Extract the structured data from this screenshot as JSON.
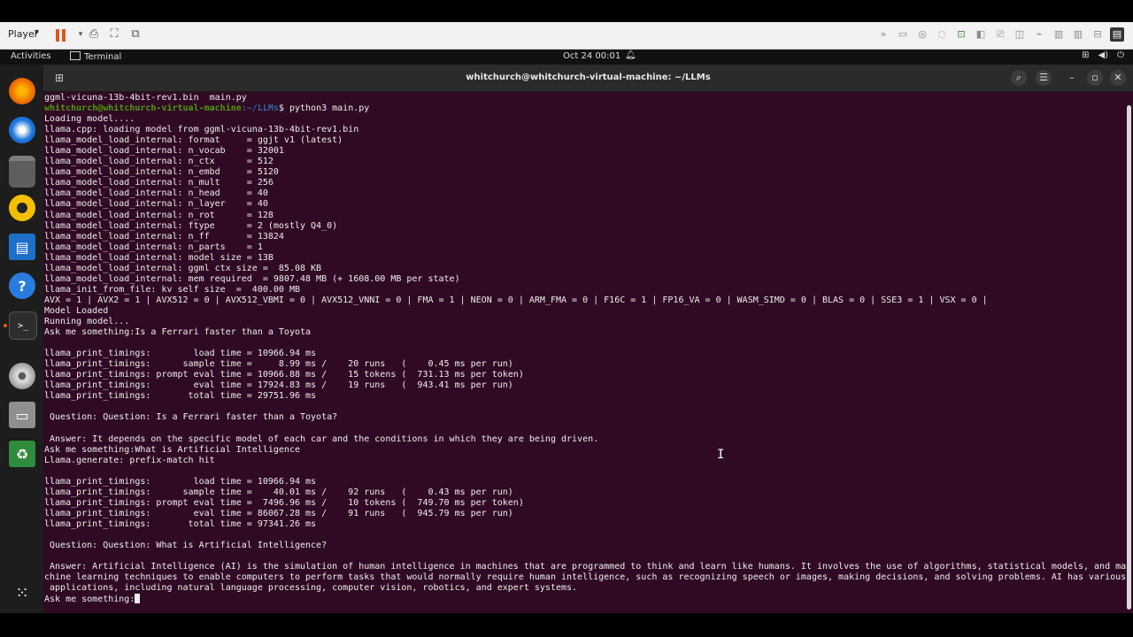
{
  "player": {
    "label": "Player",
    "icons": [
      "pause-icon",
      "devices-icon",
      "fit-window-icon",
      "unity-icon"
    ]
  },
  "topbar": {
    "activities": "Activities",
    "app_name": "Terminal",
    "clock": "Oct 24  00:01"
  },
  "dock": {
    "items": [
      {
        "name": "firefox-icon",
        "color": "#e66000"
      },
      {
        "name": "thunderbird-icon",
        "color": "#1a74d9"
      },
      {
        "name": "files-icon",
        "color": "#5e5e5e"
      },
      {
        "name": "rhythmbox-icon",
        "color": "#f3c000"
      },
      {
        "name": "writer-icon",
        "color": "#1e6fc7"
      },
      {
        "name": "help-icon",
        "color": "#2a7bde"
      },
      {
        "name": "terminal-icon",
        "color": "#2d2d2d"
      },
      {
        "name": "disc-icon",
        "color": "#bcbcbc"
      },
      {
        "name": "floppy-icon",
        "color": "#8f8f8f"
      },
      {
        "name": "trash-icon",
        "color": "#2f8c3c"
      },
      {
        "name": "app-grid-icon",
        "color": "#1d1d1d"
      }
    ]
  },
  "terminal": {
    "title": "whitchurch@whitchurch-virtual-machine: ~/LLMs",
    "prompt_user": "whitchurch@whitchurch-virtual-machine",
    "prompt_path": ":~/LLMs",
    "lines": [
      "ggml-vicuna-13b-4bit-rev1.bin  main.py",
      "$ python3 main.py",
      "Loading model....",
      "llama.cpp: loading model from ggml-vicuna-13b-4bit-rev1.bin",
      "llama_model_load_internal: format     = ggjt v1 (latest)",
      "llama_model_load_internal: n_vocab    = 32001",
      "llama_model_load_internal: n_ctx      = 512",
      "llama_model_load_internal: n_embd     = 5120",
      "llama_model_load_internal: n_mult     = 256",
      "llama_model_load_internal: n_head     = 40",
      "llama_model_load_internal: n_layer    = 40",
      "llama_model_load_internal: n_rot      = 128",
      "llama_model_load_internal: ftype      = 2 (mostly Q4_0)",
      "llama_model_load_internal: n_ff       = 13824",
      "llama_model_load_internal: n_parts    = 1",
      "llama_model_load_internal: model size = 13B",
      "llama_model_load_internal: ggml ctx size =  85.08 KB",
      "llama_model_load_internal: mem required  = 9807.48 MB (+ 1608.00 MB per state)",
      "llama_init_from_file: kv self size  =  400.00 MB",
      "AVX = 1 | AVX2 = 1 | AVX512 = 0 | AVX512_VBMI = 0 | AVX512_VNNI = 0 | FMA = 1 | NEON = 0 | ARM_FMA = 0 | F16C = 1 | FP16_VA = 0 | WASM_SIMD = 0 | BLAS = 0 | SSE3 = 1 | VSX = 0 |",
      "Model Loaded",
      "Running model...",
      "Ask me something:Is a Ferrari faster than a Toyota",
      "",
      "llama_print_timings:        load time = 10966.94 ms",
      "llama_print_timings:      sample time =     8.99 ms /    20 runs   (    0.45 ms per run)",
      "llama_print_timings: prompt eval time = 10966.88 ms /    15 tokens (  731.13 ms per token)",
      "llama_print_timings:        eval time = 17924.83 ms /    19 runs   (  943.41 ms per run)",
      "llama_print_timings:       total time = 29751.96 ms",
      "",
      " Question: Question: Is a Ferrari faster than a Toyota?",
      "",
      " Answer: It depends on the specific model of each car and the conditions in which they are being driven.",
      "Ask me something:What is Artificial Intelligence",
      "Llama.generate: prefix-match hit",
      "",
      "llama_print_timings:        load time = 10966.94 ms",
      "llama_print_timings:      sample time =    40.01 ms /    92 runs   (    0.43 ms per run)",
      "llama_print_timings: prompt eval time =  7496.96 ms /    10 tokens (  749.70 ms per token)",
      "llama_print_timings:        eval time = 86067.28 ms /    91 runs   (  945.79 ms per run)",
      "llama_print_timings:       total time = 97341.26 ms",
      "",
      " Question: Question: What is Artificial Intelligence?",
      "",
      " Answer: Artificial Intelligence (AI) is the simulation of human intelligence in machines that are programmed to think and learn like humans. It involves the use of algorithms, statistical models, and ma",
      "chine learning techniques to enable computers to perform tasks that would normally require human intelligence, such as recognizing speech or images, making decisions, and solving problems. AI has various",
      " applications, including natural language processing, computer vision, robotics, and expert systems.",
      "Ask me something:"
    ]
  }
}
